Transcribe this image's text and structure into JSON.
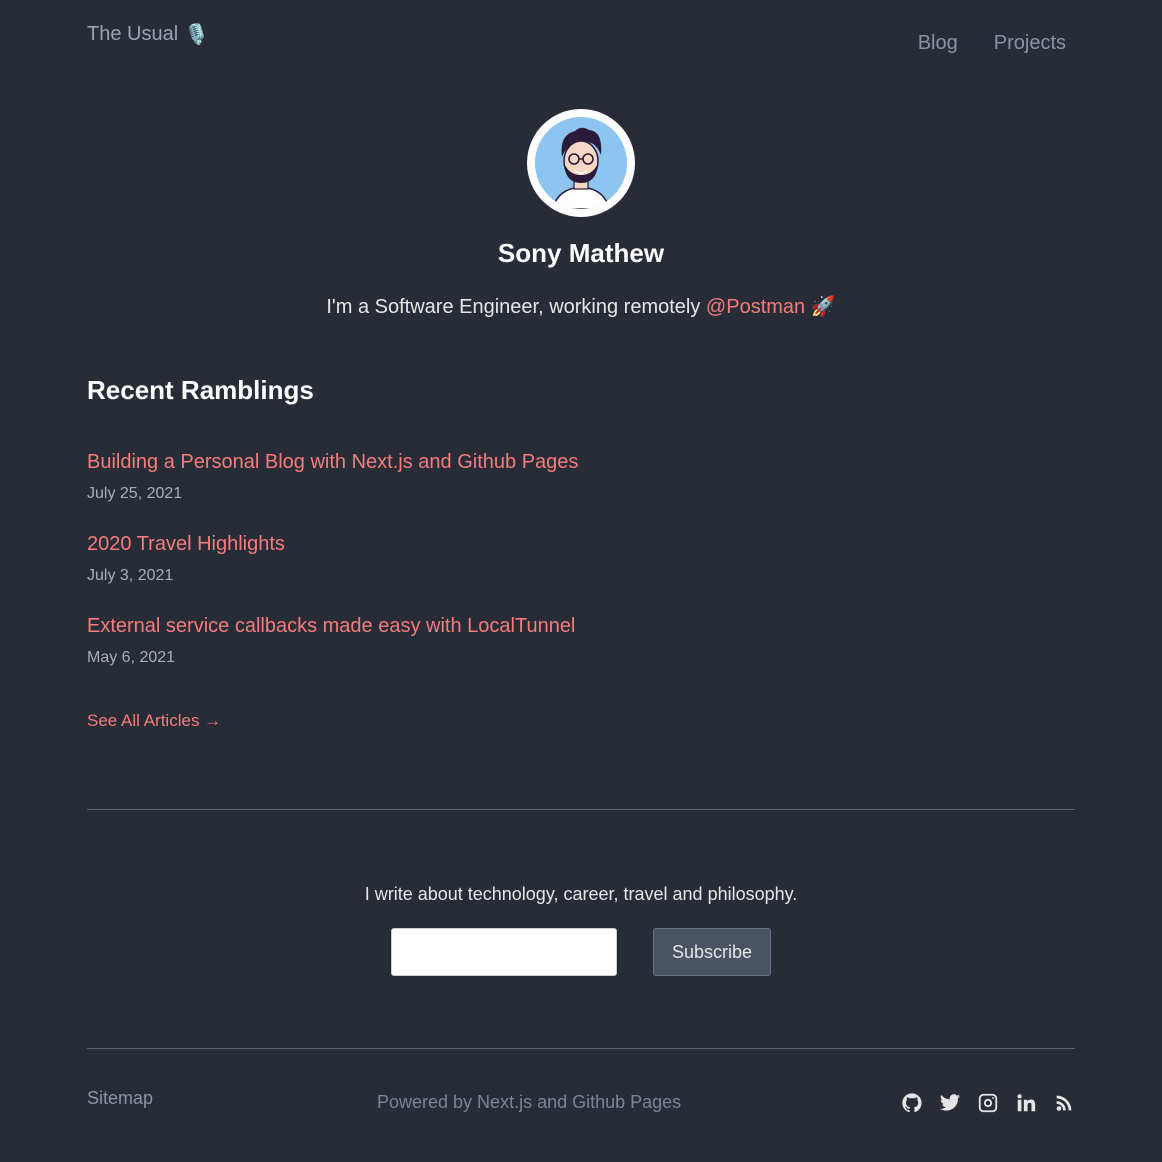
{
  "header": {
    "brand": "The Usual",
    "brand_icon": "microphone-icon",
    "nav": [
      {
        "label": "Blog"
      },
      {
        "label": "Projects"
      }
    ]
  },
  "profile": {
    "name": "Sony Mathew",
    "tagline_prefix": "I'm a Software Engineer, working remotely ",
    "tagline_link": "@Postman",
    "tagline_emoji": "🚀"
  },
  "recent": {
    "title": "Recent Ramblings",
    "articles": [
      {
        "title": "Building a Personal Blog with Next.js and Github Pages",
        "date": "July 25, 2021"
      },
      {
        "title": "2020 Travel Highlights",
        "date": "July 3, 2021"
      },
      {
        "title": "External service callbacks made easy with LocalTunnel",
        "date": "May 6, 2021"
      }
    ],
    "see_all": "See All Articles →"
  },
  "subscribe": {
    "text": "I write about technology, career, travel and philosophy.",
    "input_value": "",
    "input_placeholder": "",
    "button": "Subscribe"
  },
  "footer": {
    "sitemap": "Sitemap",
    "powered": "Powered by Next.js and Github Pages",
    "socials": [
      "github-icon",
      "twitter-icon",
      "instagram-icon",
      "linkedin-icon",
      "rss-icon"
    ]
  },
  "colors": {
    "background": "#282c36",
    "accent": "#f47c7c",
    "muted": "#8a93a3",
    "button_bg": "#4a5263"
  }
}
